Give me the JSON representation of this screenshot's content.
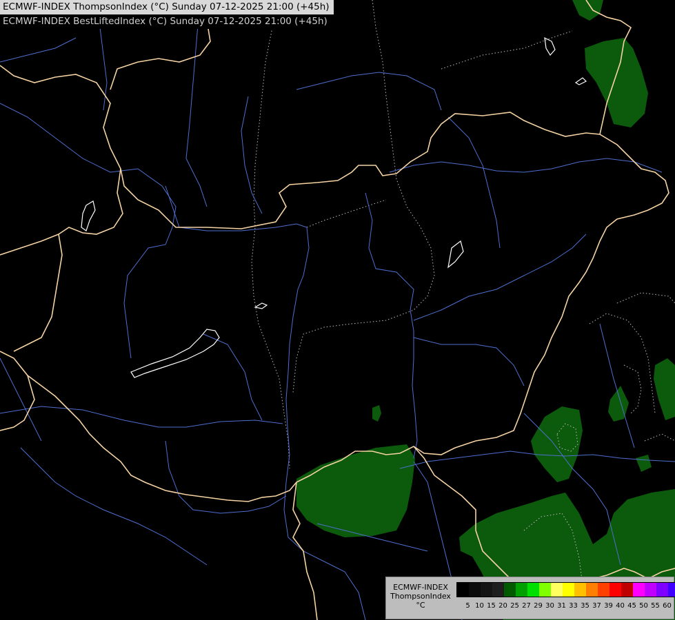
{
  "titles": {
    "line1": "ECMWF-INDEX ThompsonIndex (°C) Sunday 07-12-2025 21:00 (+45h)",
    "line2": "ECMWF-INDEX BestLiftedIndex (°C) Sunday 07-12-2025 21:00 (+45h)"
  },
  "legend": {
    "line1": "ECMWF-INDEX",
    "line2": "ThompsonIndex",
    "unit": "°C",
    "ticks": [
      "5",
      "10",
      "15",
      "20",
      "25",
      "27",
      "29",
      "30",
      "31",
      "33",
      "35",
      "37",
      "39",
      "40",
      "45",
      "50",
      "55",
      "60"
    ],
    "colors": [
      "#000000",
      "#0a0a0a",
      "#141414",
      "#1e1e1e",
      "#005a00",
      "#00a000",
      "#00e000",
      "#80ff00",
      "#ffff60",
      "#ffff00",
      "#ffc000",
      "#ff8000",
      "#ff4000",
      "#ff0000",
      "#c00000",
      "#ff00ff",
      "#c000ff",
      "#8000ff",
      "#4000ff",
      "#0000ff"
    ]
  },
  "map_colors": {
    "background": "#000000",
    "border": "#f6d3a3",
    "river": "#4f6fd0",
    "lake": "#ffffff",
    "isoline": "#bdbdbd",
    "fill_low": "#005300",
    "fill_mid": "#136c13"
  }
}
